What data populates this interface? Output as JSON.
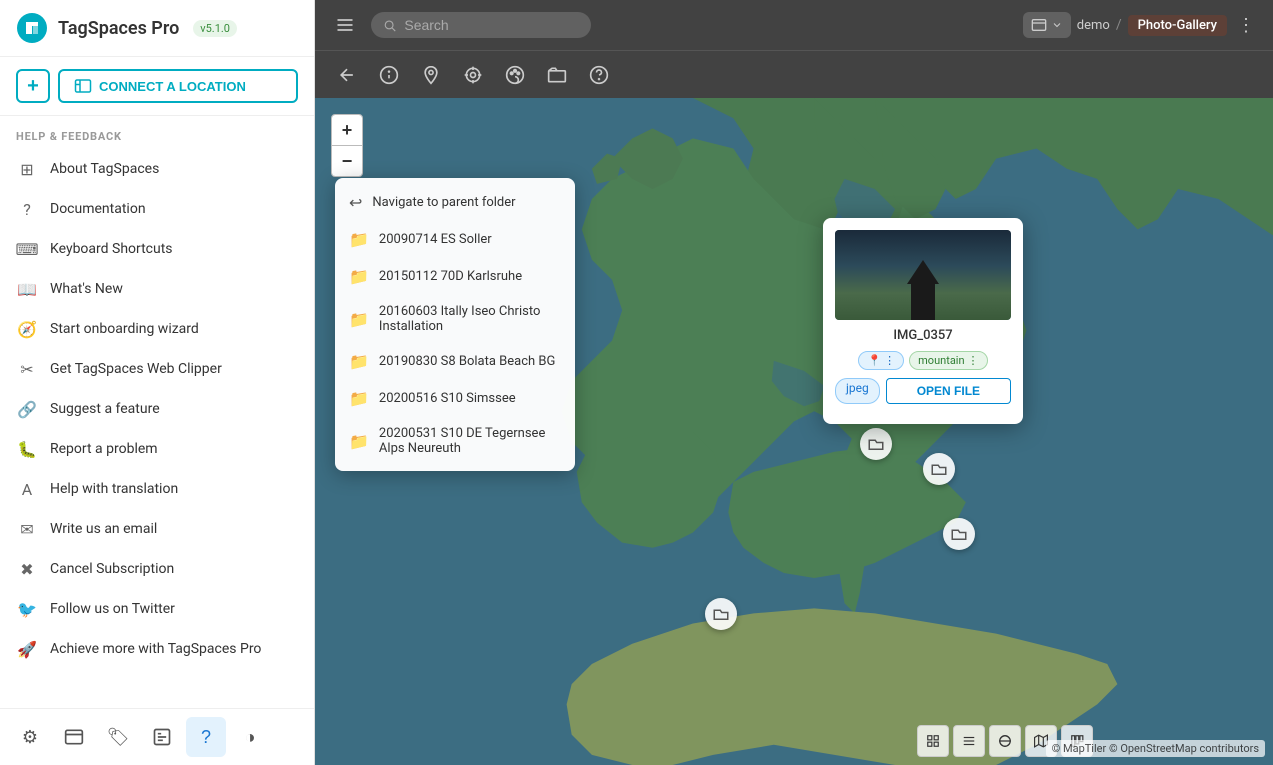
{
  "app": {
    "name": "TagSpaces Pro",
    "version": "v5.1.0"
  },
  "sidebar": {
    "connect_label": "CONNECT A LOCATION",
    "add_icon": "+",
    "section_header": "HELP & FEEDBACK",
    "menu_items": [
      {
        "id": "about",
        "label": "About TagSpaces",
        "icon": "⊞"
      },
      {
        "id": "docs",
        "label": "Documentation",
        "icon": "?"
      },
      {
        "id": "shortcuts",
        "label": "Keyboard Shortcuts",
        "icon": "⌨"
      },
      {
        "id": "whats-new",
        "label": "What's New",
        "icon": "📖"
      },
      {
        "id": "onboarding",
        "label": "Start onboarding wizard",
        "icon": "🧭"
      },
      {
        "id": "web-clipper",
        "label": "Get TagSpaces Web Clipper",
        "icon": "✂"
      },
      {
        "id": "feature",
        "label": "Suggest a feature",
        "icon": "🔗"
      },
      {
        "id": "problem",
        "label": "Report a problem",
        "icon": "🐛"
      },
      {
        "id": "translation",
        "label": "Help with translation",
        "icon": "A"
      },
      {
        "id": "email",
        "label": "Write us an email",
        "icon": "✉"
      },
      {
        "id": "cancel",
        "label": "Cancel Subscription",
        "icon": "✖"
      },
      {
        "id": "twitter",
        "label": "Follow us on Twitter",
        "icon": "🐦"
      },
      {
        "id": "achieve",
        "label": "Achieve more with TagSpaces Pro",
        "icon": "🚀"
      }
    ],
    "footer_buttons": [
      {
        "id": "settings",
        "icon": "⚙",
        "label": "Settings"
      },
      {
        "id": "locations",
        "icon": "🗂",
        "label": "Locations"
      },
      {
        "id": "tags",
        "icon": "🏷",
        "label": "Tags"
      },
      {
        "id": "recently",
        "icon": "🕐",
        "label": "Recently"
      },
      {
        "id": "help",
        "icon": "?",
        "label": "Help",
        "active": true
      },
      {
        "id": "theme",
        "icon": "◑",
        "label": "Theme"
      }
    ]
  },
  "topbar": {
    "menu_icon": "≡",
    "search_placeholder": "Search",
    "breadcrumb_root": "demo",
    "breadcrumb_sep": "/",
    "breadcrumb_current": "Photo-Gallery",
    "more_icon": "⋮"
  },
  "toolbar2": {
    "buttons": [
      {
        "id": "back",
        "icon": "↩"
      },
      {
        "id": "info",
        "icon": "ℹ"
      },
      {
        "id": "location",
        "icon": "📍"
      },
      {
        "id": "target",
        "icon": "⊙"
      },
      {
        "id": "palette",
        "icon": "🎨"
      },
      {
        "id": "folder-open",
        "icon": "📁"
      },
      {
        "id": "question",
        "icon": "?"
      }
    ]
  },
  "folder_panel": {
    "items": [
      {
        "id": "navigate-parent",
        "label": "Navigate to parent folder",
        "icon": "↩",
        "is_folder": false
      },
      {
        "id": "folder-1",
        "label": "20090714 ES Soller",
        "icon": "📁"
      },
      {
        "id": "folder-2",
        "label": "20150112 70D Karlsruhe",
        "icon": "📁"
      },
      {
        "id": "folder-3",
        "label": "20160603 Itally Iseo Christo Installation",
        "icon": "📁"
      },
      {
        "id": "folder-4",
        "label": "20190830 S8 Bolata Beach BG",
        "icon": "📁"
      },
      {
        "id": "folder-5",
        "label": "20200516 S10 Simssee",
        "icon": "📁"
      },
      {
        "id": "folder-6",
        "label": "20200531 S10 DE Tegernsee Alps Neureuth",
        "icon": "📁"
      }
    ]
  },
  "image_popup": {
    "filename": "IMG_0357",
    "close_icon": "×",
    "tag_location": "📍",
    "tag_more": "⋮",
    "tag_mountain": "mountain",
    "tag_mountain_more": "⋮",
    "tag_jpeg": "jpeg",
    "open_file_label": "OPEN FILE"
  },
  "map": {
    "zoom_in": "+",
    "zoom_out": "−",
    "attribution": "© MapTiler © OpenStreetMap contributors"
  }
}
